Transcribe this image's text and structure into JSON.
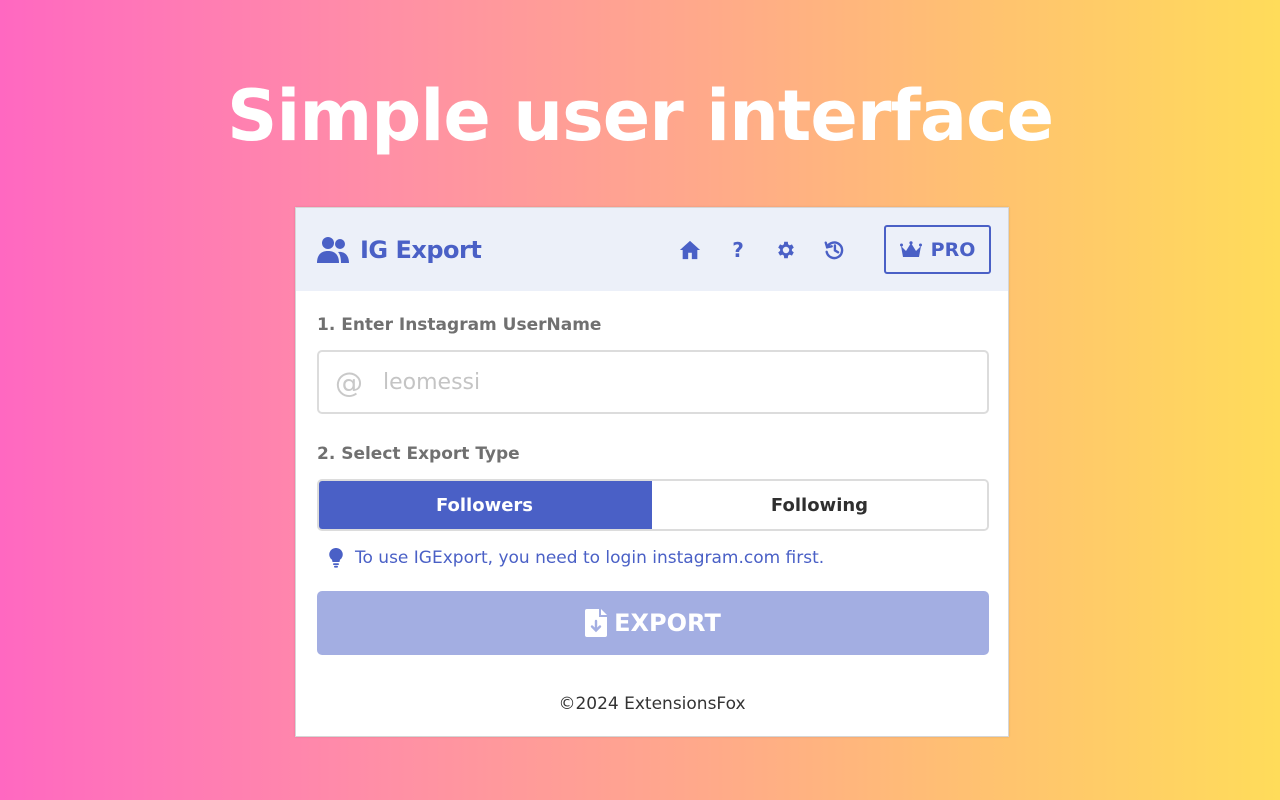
{
  "banner": {
    "headline": "Simple user interface"
  },
  "colors": {
    "accent": "#4a60c6",
    "header_bg": "#ecf0f9",
    "export_disabled": "#a3aee2",
    "gradient_start": "#ff68c1",
    "gradient_end": "#ffdc5a"
  },
  "header": {
    "logo_icon": "users-icon",
    "title": "IG Export",
    "nav": [
      {
        "name": "home",
        "icon": "home-icon"
      },
      {
        "name": "help",
        "icon": "question-icon",
        "glyph": "?"
      },
      {
        "name": "settings",
        "icon": "gear-icon"
      },
      {
        "name": "history",
        "icon": "history-icon"
      }
    ],
    "pro_button": {
      "icon": "crown-icon",
      "label": "PRO"
    }
  },
  "form": {
    "step1_label": "1. Enter Instagram UserName",
    "username": {
      "icon": "at-icon",
      "prefix": "@",
      "value": "",
      "placeholder": "leomessi"
    },
    "step2_label": "2. Select Export Type",
    "export_types": [
      {
        "label": "Followers",
        "selected": true
      },
      {
        "label": "Following",
        "selected": false
      }
    ],
    "tip": {
      "icon": "lightbulb-icon",
      "text": "To use IGExport, you need to login instagram.com first."
    },
    "export_button": {
      "icon": "file-download-icon",
      "label": "EXPORT",
      "disabled": true
    }
  },
  "footer": {
    "copyright": "©2024 ExtensionsFox"
  }
}
